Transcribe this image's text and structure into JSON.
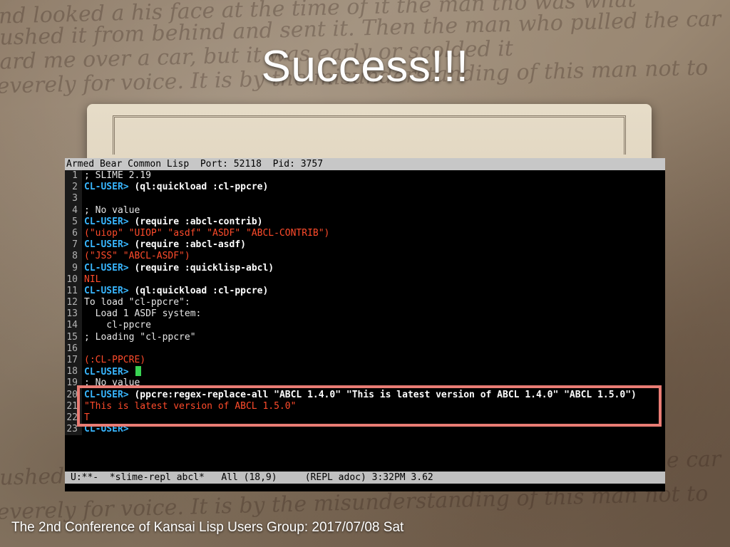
{
  "slide": {
    "title": "Success!!!",
    "footer": "The 2nd Conference of Kansai Lisp Users Group: 2017/07/08 Sat"
  },
  "terminal": {
    "header": "Armed Bear Common Lisp  Port: 52118  Pid: 3757",
    "lines": [
      {
        "num": "1",
        "segments": [
          {
            "text": "; SLIME 2.19",
            "style": "comment"
          }
        ]
      },
      {
        "num": "2",
        "segments": [
          {
            "text": "CL-USER> ",
            "style": "prompt"
          },
          {
            "text": "(ql:quickload :cl-ppcre)",
            "style": "cmd"
          }
        ]
      },
      {
        "num": "3",
        "segments": []
      },
      {
        "num": "4",
        "segments": [
          {
            "text": "; No value",
            "style": "comment"
          }
        ]
      },
      {
        "num": "5",
        "segments": [
          {
            "text": "CL-USER> ",
            "style": "prompt"
          },
          {
            "text": "(require :abcl-contrib)",
            "style": "cmd"
          }
        ]
      },
      {
        "num": "6",
        "segments": [
          {
            "text": "(\"uiop\" \"UIOP\" \"asdf\" \"ASDF\" \"ABCL-CONTRIB\")",
            "style": "red"
          }
        ]
      },
      {
        "num": "7",
        "segments": [
          {
            "text": "CL-USER> ",
            "style": "prompt"
          },
          {
            "text": "(require :abcl-asdf)",
            "style": "cmd"
          }
        ]
      },
      {
        "num": "8",
        "segments": [
          {
            "text": "(\"JSS\" \"ABCL-ASDF\")",
            "style": "red"
          }
        ]
      },
      {
        "num": "9",
        "segments": [
          {
            "text": "CL-USER> ",
            "style": "prompt"
          },
          {
            "text": "(require :quicklisp-abcl)",
            "style": "cmd"
          }
        ]
      },
      {
        "num": "10",
        "segments": [
          {
            "text": "NIL",
            "style": "red"
          }
        ]
      },
      {
        "num": "11",
        "segments": [
          {
            "text": "CL-USER> ",
            "style": "prompt"
          },
          {
            "text": "(ql:quickload :cl-ppcre)",
            "style": "cmd"
          }
        ]
      },
      {
        "num": "12",
        "segments": [
          {
            "text": "To load \"cl-ppcre\":",
            "style": "comment"
          }
        ]
      },
      {
        "num": "13",
        "segments": [
          {
            "text": "  Load 1 ASDF system:",
            "style": "comment"
          }
        ]
      },
      {
        "num": "14",
        "segments": [
          {
            "text": "    cl-ppcre",
            "style": "comment"
          }
        ]
      },
      {
        "num": "15",
        "segments": [
          {
            "text": "; Loading \"cl-ppcre\"",
            "style": "comment"
          }
        ]
      },
      {
        "num": "16",
        "segments": []
      },
      {
        "num": "17",
        "segments": [
          {
            "text": "(:CL-PPCRE)",
            "style": "red"
          }
        ]
      },
      {
        "num": "18",
        "segments": [
          {
            "text": "CL-USER> ",
            "style": "prompt"
          }
        ],
        "cursor": true
      },
      {
        "num": "19",
        "segments": [
          {
            "text": "; No value",
            "style": "comment"
          }
        ]
      },
      {
        "num": "20",
        "segments": [
          {
            "text": "CL-USER> ",
            "style": "prompt"
          },
          {
            "text": "(ppcre:regex-replace-all \"ABCL 1.4.0\" \"This is latest version of ABCL 1.4.0\" \"ABCL 1.5.0\")",
            "style": "cmd"
          }
        ]
      },
      {
        "num": "21",
        "segments": [
          {
            "text": "\"This is latest version of ABCL 1.5.0\"",
            "style": "red"
          }
        ]
      },
      {
        "num": "22",
        "segments": [
          {
            "text": "T",
            "style": "red"
          }
        ]
      },
      {
        "num": "23",
        "segments": [
          {
            "text": "CL-USER> ",
            "style": "prompt"
          }
        ]
      }
    ],
    "modeline": "U:**-  *slime-repl abcl*   All (18,9)     (REPL adoc) 3:32PM 3.62"
  },
  "colors": {
    "prompt": "#38b6ff",
    "output": "#ff4b2b",
    "cursor": "#39d353",
    "highlight_box": "#e97c74"
  }
}
